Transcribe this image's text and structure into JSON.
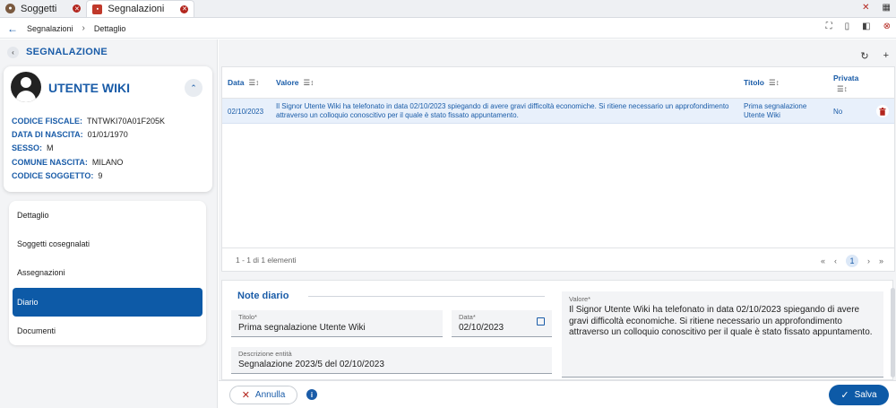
{
  "tabs": [
    {
      "label": "Soggetti",
      "icon": "person-icon",
      "active": false
    },
    {
      "label": "Segnalazioni",
      "icon": "report-icon",
      "active": true
    }
  ],
  "breadcrumb": {
    "items": [
      "Segnalazioni",
      "Dettaglio"
    ]
  },
  "left": {
    "title": "SEGNALAZIONE",
    "card": {
      "name": "UTENTE WIKI",
      "fields": [
        {
          "label": "CODICE FISCALE:",
          "value": "TNTWKI70A01F205K"
        },
        {
          "label": "DATA DI NASCITA:",
          "value": "01/01/1970"
        },
        {
          "label": "SESSO:",
          "value": "M"
        },
        {
          "label": "COMUNE NASCITA:",
          "value": "MILANO"
        },
        {
          "label": "CODICE SOGGETTO:",
          "value": "9"
        }
      ]
    },
    "menu": [
      {
        "label": "Dettaglio",
        "selected": false
      },
      {
        "label": "Soggetti cosegnalati",
        "selected": false
      },
      {
        "label": "Assegnazioni",
        "selected": false
      },
      {
        "label": "Diario",
        "selected": true
      },
      {
        "label": "Documenti",
        "selected": false
      }
    ]
  },
  "table": {
    "headers": {
      "data": "Data",
      "valore": "Valore",
      "titolo": "Titolo",
      "privata": "Privata"
    },
    "rows": [
      {
        "data": "02/10/2023",
        "valore": "Il Signor Utente Wiki ha telefonato in data 02/10/2023 spiegando di avere gravi difficoltà economiche. Si ritiene necessario un approfondimento attraverso un colloquio conoscitivo per il quale è stato fissato appuntamento.",
        "titolo": "Prima segnalazione Utente Wiki",
        "privata": "No"
      }
    ],
    "pagination": {
      "summary": "1 - 1 di 1 elementi",
      "current_page": "1"
    }
  },
  "form": {
    "title": "Note diario",
    "titolo": {
      "label": "Titolo*",
      "value": "Prima segnalazione Utente Wiki"
    },
    "data": {
      "label": "Data*",
      "value": "02/10/2023"
    },
    "descrizione": {
      "label": "Descrizione entità",
      "value": "Segnalazione 2023/5 del 02/10/2023"
    },
    "valore": {
      "label": "Valore*",
      "value": "Il Signor Utente Wiki ha telefonato in data 02/10/2023 spiegando di avere gravi difficoltà economiche. Si ritiene necessario un approfondimento attraverso un colloquio conoscitivo per il quale è stato fissato appuntamento."
    }
  },
  "footer": {
    "cancel_label": "Annulla",
    "save_label": "Salva"
  },
  "colors": {
    "accent": "#0d5aa7",
    "danger": "#b3261e",
    "selected_row": "#e8f0fb"
  }
}
